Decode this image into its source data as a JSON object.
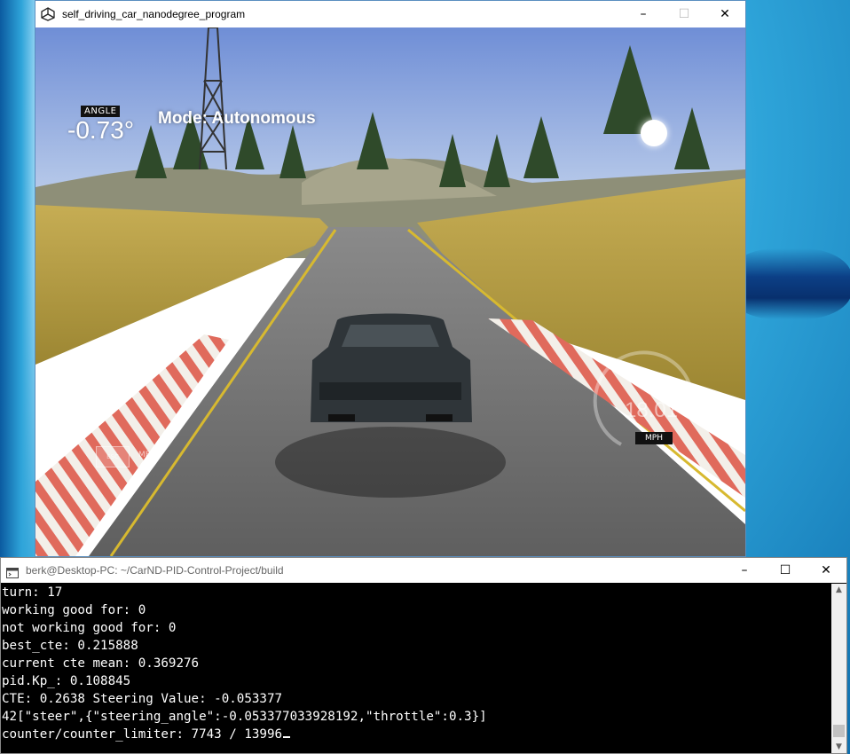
{
  "game_window": {
    "title": "self_driving_car_nanodegree_program",
    "controls": {
      "minimize": "–",
      "maximize": "☐",
      "close": "✕"
    },
    "hud": {
      "angle_label": "ANGLE",
      "angle_value": "-0.73°",
      "mode_text": "Mode: Autonomous",
      "esc_label": "ESC",
      "menu_label": "MENU",
      "speed_value": "18.01",
      "speed_unit": "MPH"
    }
  },
  "terminal_window": {
    "title": "berk@Desktop-PC: ~/CarND-PID-Control-Project/build",
    "controls": {
      "minimize": "–",
      "maximize": "☐",
      "close": "✕"
    },
    "lines": [
      "turn: 17",
      "working good for: 0",
      "not working good for: 0",
      "best_cte: 0.215888",
      "current cte mean: 0.369276",
      "pid.Kp_: 0.108845",
      "CTE: 0.2638 Steering Value: -0.053377",
      "42[\"steer\",{\"steering_angle\":-0.053377033928192,\"throttle\":0.3}]",
      "counter/counter_limiter: 7743 / 13996"
    ]
  },
  "colors": {
    "sky_top": "#6f8ed6",
    "sky_bottom": "#c9d8ee",
    "grass": "#b49a3c",
    "road": "#6b6b6b",
    "curb_red": "#e06a5c",
    "terminal_bg": "#000000",
    "terminal_fg": "#ffffff"
  }
}
